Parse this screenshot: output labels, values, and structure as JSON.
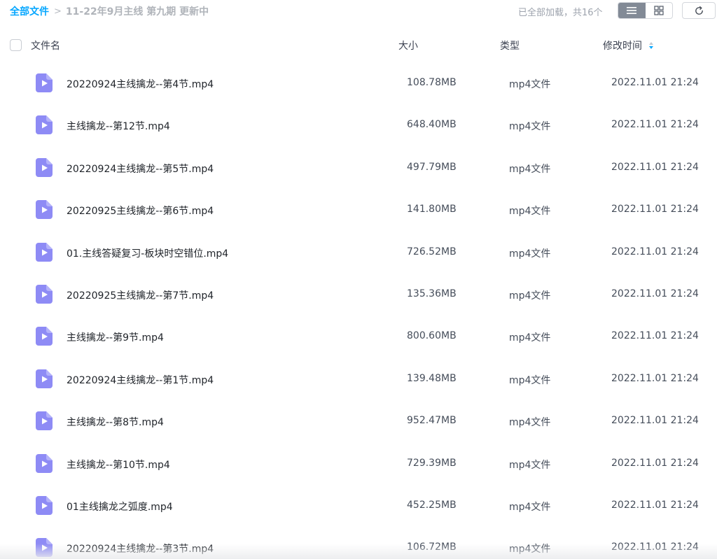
{
  "breadcrumb": {
    "root": "全部文件",
    "separator": ">",
    "current": "11-22年9月主线 第九期 更新中"
  },
  "status": {
    "loaded_text": "已全部加载，共16个"
  },
  "toolbar": {
    "view_mode": "list",
    "icons": [
      "list-view-icon",
      "grid-view-icon",
      "refresh-icon"
    ]
  },
  "columns": {
    "name": "文件名",
    "size": "大小",
    "type": "类型",
    "time": "修改时间"
  },
  "colors": {
    "accent": "#06a7ff",
    "video_icon": "#8e8bf5"
  },
  "files": [
    {
      "name": "20220924主线擒龙--第4节.mp4",
      "size": "108.78MB",
      "type": "mp4文件",
      "time": "2022.11.01 21:24"
    },
    {
      "name": "主线擒龙--第12节.mp4",
      "size": "648.40MB",
      "type": "mp4文件",
      "time": "2022.11.01 21:24"
    },
    {
      "name": "20220924主线擒龙--第5节.mp4",
      "size": "497.79MB",
      "type": "mp4文件",
      "time": "2022.11.01 21:24"
    },
    {
      "name": "20220925主线擒龙--第6节.mp4",
      "size": "141.80MB",
      "type": "mp4文件",
      "time": "2022.11.01 21:24"
    },
    {
      "name": "01.主线答疑复习-板块时空错位.mp4",
      "size": "726.52MB",
      "type": "mp4文件",
      "time": "2022.11.01 21:24"
    },
    {
      "name": "20220925主线擒龙--第7节.mp4",
      "size": "135.36MB",
      "type": "mp4文件",
      "time": "2022.11.01 21:24"
    },
    {
      "name": "主线擒龙--第9节.mp4",
      "size": "800.60MB",
      "type": "mp4文件",
      "time": "2022.11.01 21:24"
    },
    {
      "name": "20220924主线擒龙--第1节.mp4",
      "size": "139.48MB",
      "type": "mp4文件",
      "time": "2022.11.01 21:24"
    },
    {
      "name": "主线擒龙--第8节.mp4",
      "size": "952.47MB",
      "type": "mp4文件",
      "time": "2022.11.01 21:24"
    },
    {
      "name": "主线擒龙--第10节.mp4",
      "size": "729.39MB",
      "type": "mp4文件",
      "time": "2022.11.01 21:24"
    },
    {
      "name": "01主线擒龙之弧度.mp4",
      "size": "452.25MB",
      "type": "mp4文件",
      "time": "2022.11.01 21:24"
    },
    {
      "name": "20220924主线擒龙--第3节.mp4",
      "size": "106.72MB",
      "type": "mp4文件",
      "time": "2022.11.01 21:24"
    }
  ]
}
